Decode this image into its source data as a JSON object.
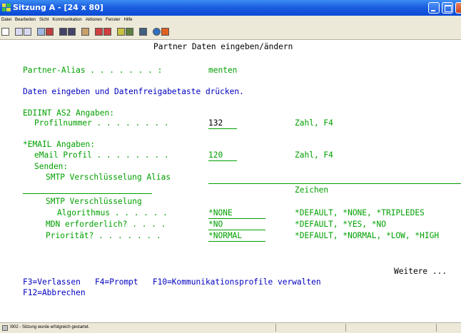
{
  "window": {
    "title": "Sitzung A - [24 x 80]"
  },
  "menu": [
    "Datei",
    "Bearbeiten",
    "Sicht",
    "Kommunikation",
    "Aktionen",
    "Fenster",
    "Hilfe"
  ],
  "toolbar": {
    "icons": [
      "print-screen-icon",
      "copy-icon",
      "paste-icon",
      "send-icon",
      "receive-icon",
      "display-icon",
      "keyboard-icon",
      "macro-icon",
      "record-icon",
      "play-icon",
      "mail-icon",
      "settings-icon",
      "help-icon",
      "color-icon",
      "edit-icon"
    ]
  },
  "screen": {
    "title": "Partner Daten eingeben/ändern",
    "alias_label": "Partner-Alias . . . . . . . :",
    "alias_value": "menten",
    "instruction": "Daten eingeben und Datenfreigabetaste drücken.",
    "edi_header": "EDIINT AS2 Angaben:",
    "profil_label": "Profilnummer . . . . . . . .",
    "profil_value": "132",
    "profil_hint": "Zahl, F4",
    "email_header": "*EMAIL Angaben:",
    "email_label": "eMail Profil . . . . . . . .",
    "email_value": "120",
    "email_hint": "Zahl, F4",
    "senden": "Senden:",
    "smtp_alias_label": "SMTP Verschlüsselung Alias",
    "zeichen": "Zeichen",
    "smtp_label": "SMTP Verschlüsselung",
    "algo_label": "Algorithmus . . . . . .",
    "algo_value": "*NONE",
    "algo_hint": "*DEFAULT, *NONE, *TRIPLEDES",
    "mdn_label": "MDN erforderlich? . . . .",
    "mdn_value": "*NO",
    "mdn_hint": "*DEFAULT, *YES, *NO",
    "prio_label": "Priorität? . . . . . . .",
    "prio_value": "*NORMAL",
    "prio_hint": "*DEFAULT, *NORMAL, *LOW, *HIGH",
    "more": "Weitere ...",
    "fkeys_line1": "F3=Verlassen   F4=Prompt   F10=Kommunikationsprofile verwalten",
    "fkeys_line2": "F12=Abbrechen"
  },
  "status": {
    "message": "I902 - Sitzung wurde erfolgreich gestartet."
  },
  "colors": {
    "field": "#00a000",
    "text": "#000000",
    "info": "#0000c0",
    "titlebar": "#0a4ad6"
  }
}
